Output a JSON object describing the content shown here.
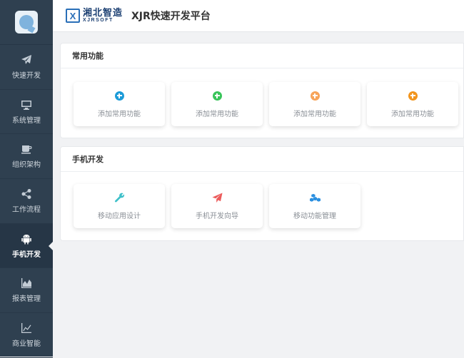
{
  "header": {
    "logo_cn": "湘北智造",
    "logo_en": "XJRSOFT",
    "logo_mark": "X",
    "title": "XJR快速开发平台"
  },
  "sidebar": {
    "items": [
      {
        "label": "快速开发",
        "icon": "paper-plane-icon",
        "active": false
      },
      {
        "label": "系统管理",
        "icon": "monitor-icon",
        "active": false
      },
      {
        "label": "组织架构",
        "icon": "coffee-icon",
        "active": false
      },
      {
        "label": "工作流程",
        "icon": "share-icon",
        "active": false
      },
      {
        "label": "手机开发",
        "icon": "android-icon",
        "active": true
      },
      {
        "label": "报表管理",
        "icon": "area-chart-icon",
        "active": false
      },
      {
        "label": "商业智能",
        "icon": "line-chart-icon",
        "active": false
      }
    ]
  },
  "common": {
    "title": "常用功能",
    "tiles": [
      {
        "label": "添加常用功能",
        "color": "#1c9bd8",
        "icon": "plus-circle-icon"
      },
      {
        "label": "添加常用功能",
        "color": "#39c45a",
        "icon": "plus-circle-icon"
      },
      {
        "label": "添加常用功能",
        "color": "#f7a45a",
        "icon": "plus-circle-icon"
      },
      {
        "label": "添加常用功能",
        "color": "#f2951e",
        "icon": "plus-circle-icon"
      }
    ]
  },
  "mobile": {
    "title": "手机开发",
    "tiles": [
      {
        "label": "移动应用设计",
        "color": "#3ec0c9",
        "icon": "wrench-icon"
      },
      {
        "label": "手机开发向导",
        "color": "#ec5b5b",
        "icon": "paper-plane-icon"
      },
      {
        "label": "移动功能管理",
        "color": "#2a8fe0",
        "icon": "cubes-icon"
      }
    ]
  }
}
